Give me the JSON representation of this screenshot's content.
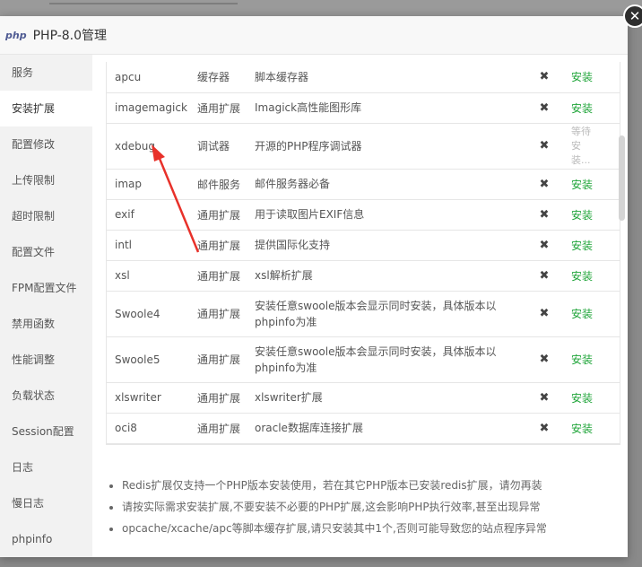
{
  "dialog": {
    "title": "PHP-8.0管理",
    "logo_text": "php",
    "close_symbol": "✕"
  },
  "sidebar": {
    "items": [
      {
        "label": "服务"
      },
      {
        "label": "安装扩展",
        "active": true
      },
      {
        "label": "配置修改"
      },
      {
        "label": "上传限制"
      },
      {
        "label": "超时限制"
      },
      {
        "label": "配置文件"
      },
      {
        "label": "FPM配置文件"
      },
      {
        "label": "禁用函数"
      },
      {
        "label": "性能调整"
      },
      {
        "label": "负载状态"
      },
      {
        "label": "Session配置"
      },
      {
        "label": "日志"
      },
      {
        "label": "慢日志"
      },
      {
        "label": "phpinfo"
      }
    ]
  },
  "extensions": [
    {
      "name": "apcu",
      "type": "缓存器",
      "desc": "脚本缓存器",
      "remove": "✖",
      "op": "安装"
    },
    {
      "name": "imagemagick",
      "type": "通用扩展",
      "desc": "Imagick高性能图形库",
      "remove": "✖",
      "op": "安装"
    },
    {
      "name": "xdebug",
      "type": "调试器",
      "desc": "开源的PHP程序调试器",
      "remove": "✖",
      "op": "等待安装...",
      "waiting": true
    },
    {
      "name": "imap",
      "type": "邮件服务",
      "desc": "邮件服务器必备",
      "remove": "✖",
      "op": "安装"
    },
    {
      "name": "exif",
      "type": "通用扩展",
      "desc": "用于读取图片EXIF信息",
      "remove": "✖",
      "op": "安装"
    },
    {
      "name": "intl",
      "type": "通用扩展",
      "desc": "提供国际化支持",
      "remove": "✖",
      "op": "安装"
    },
    {
      "name": "xsl",
      "type": "通用扩展",
      "desc": "xsl解析扩展",
      "remove": "✖",
      "op": "安装"
    },
    {
      "name": "Swoole4",
      "type": "通用扩展",
      "desc": "安装任意swoole版本会显示同时安装，具体版本以phpinfo为准",
      "remove": "✖",
      "op": "安装"
    },
    {
      "name": "Swoole5",
      "type": "通用扩展",
      "desc": "安装任意swoole版本会显示同时安装，具体版本以phpinfo为准",
      "remove": "✖",
      "op": "安装"
    },
    {
      "name": "xlswriter",
      "type": "通用扩展",
      "desc": "xlswriter扩展",
      "remove": "✖",
      "op": "安装"
    },
    {
      "name": "oci8",
      "type": "通用扩展",
      "desc": "oracle数据库连接扩展",
      "remove": "✖",
      "op": "安装"
    }
  ],
  "notes": [
    "Redis扩展仅支持一个PHP版本安装使用，若在其它PHP版本已安装redis扩展，请勿再装",
    "请按实际需求安装扩展,不要安装不必要的PHP扩展,这会影响PHP执行效率,甚至出现异常",
    "opcache/xcache/apc等脚本缓存扩展,请只安装其中1个,否则可能导致您的站点程序异常"
  ],
  "colors": {
    "install": "#20a53a",
    "annotation_arrow": "#e8312a",
    "logo": "#4f5b93"
  }
}
